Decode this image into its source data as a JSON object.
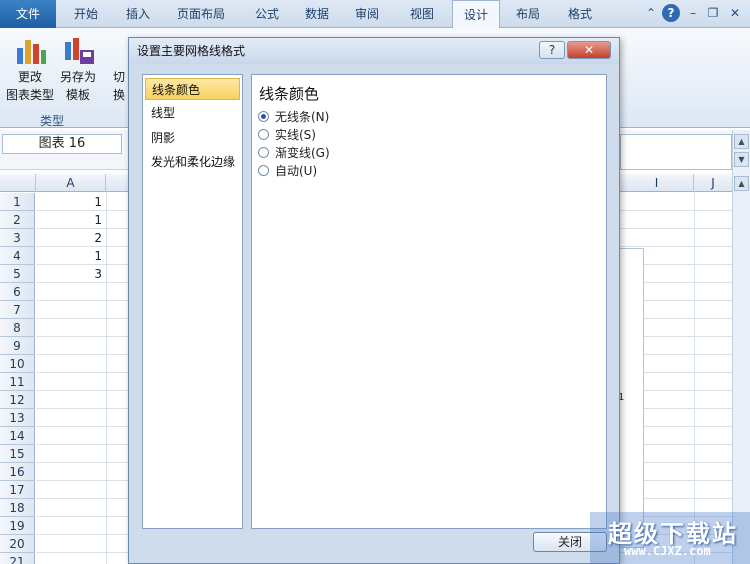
{
  "ribbon": {
    "tabs": [
      "文件",
      "开始",
      "插入",
      "页面布局",
      "公式",
      "数据",
      "审阅",
      "视图",
      "设计",
      "布局",
      "格式"
    ],
    "active_tab": "设计",
    "buttons": {
      "change_type": [
        "更改",
        "图表类型"
      ],
      "save_template": [
        "另存为",
        "模板"
      ],
      "switch": "切换"
    },
    "group_label": "类型"
  },
  "formula_bar": {
    "name_box": "图表 16"
  },
  "grid": {
    "columns": [
      "A",
      "I",
      "J"
    ],
    "rows": [
      "1",
      "2",
      "3",
      "4",
      "5",
      "6",
      "7",
      "8",
      "9",
      "10",
      "11",
      "12",
      "13",
      "14",
      "15",
      "16",
      "17",
      "18",
      "19",
      "20",
      "21"
    ],
    "col_a_values": [
      "1",
      "1",
      "2",
      "1",
      "3"
    ],
    "chart_edge_text": "1"
  },
  "dialog": {
    "title": "设置主要网格线格式",
    "help_label": "?",
    "close_label": "✕",
    "nav_items": [
      "线条颜色",
      "线型",
      "阴影",
      "发光和柔化边缘"
    ],
    "selected_nav": "线条颜色",
    "content_title": "线条颜色",
    "options": [
      {
        "label": "无线条(N)",
        "checked": true
      },
      {
        "label": "实线(S)",
        "checked": false
      },
      {
        "label": "渐变线(G)",
        "checked": false
      },
      {
        "label": "自动(U)",
        "checked": false
      }
    ],
    "close_button": "关闭"
  },
  "watermark": {
    "title": "超级下载站",
    "url": "www.CJXZ.com"
  },
  "colors": {
    "file_tab": "#2b6fb8",
    "selected_nav": "#f8d161",
    "radio_dot": "#2a5aa6"
  }
}
